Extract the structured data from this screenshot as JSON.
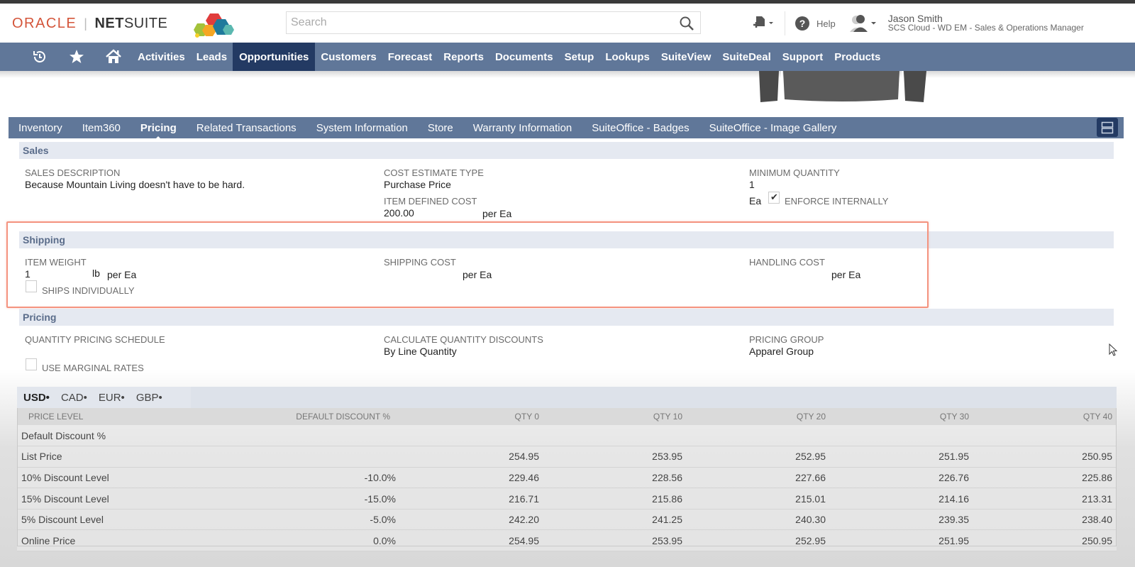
{
  "header": {
    "logo_oracle": "ORACLE",
    "logo_net": "NET",
    "logo_suite": "SUITE",
    "search_placeholder": "Search",
    "help_label": "Help",
    "user_name": "Jason Smith",
    "user_role": "SCS Cloud - WD EM - Sales & Operations Manager"
  },
  "nav": {
    "icons": [
      "recent-history-icon",
      "star-icon",
      "home-icon"
    ],
    "items": [
      {
        "label": "Activities",
        "active": false
      },
      {
        "label": "Leads",
        "active": false
      },
      {
        "label": "Opportunities",
        "active": true
      },
      {
        "label": "Customers",
        "active": false
      },
      {
        "label": "Forecast",
        "active": false
      },
      {
        "label": "Reports",
        "active": false
      },
      {
        "label": "Documents",
        "active": false
      },
      {
        "label": "Setup",
        "active": false
      },
      {
        "label": "Lookups",
        "active": false
      },
      {
        "label": "SuiteView",
        "active": false
      },
      {
        "label": "SuiteDeal",
        "active": false
      },
      {
        "label": "Support",
        "active": false
      },
      {
        "label": "Products",
        "active": false
      }
    ]
  },
  "subtabs": [
    {
      "label": "Inventory",
      "active": false
    },
    {
      "label": "Item360",
      "active": false
    },
    {
      "label": "Pricing",
      "active": true
    },
    {
      "label": "Related Transactions",
      "active": false
    },
    {
      "label": "System Information",
      "active": false
    },
    {
      "label": "Store",
      "active": false
    },
    {
      "label": "Warranty Information",
      "active": false
    },
    {
      "label": "SuiteOffice - Badges",
      "active": false
    },
    {
      "label": "SuiteOffice - Image Gallery",
      "active": false
    }
  ],
  "sales": {
    "title": "Sales",
    "sales_description_label": "Sales Description",
    "sales_description": "Because Mountain Living doesn't have to be hard.",
    "cost_estimate_type_label": "Cost Estimate Type",
    "cost_estimate_type": "Purchase Price",
    "item_defined_cost_label": "Item Defined Cost",
    "item_defined_cost": "200.00",
    "item_defined_cost_unit": "per Ea",
    "minimum_quantity_label": "Minimum Quantity",
    "minimum_quantity": "1",
    "minimum_quantity_unit": "Ea",
    "enforce_internally_label": "Enforce Internally",
    "enforce_internally": true
  },
  "shipping": {
    "title": "Shipping",
    "item_weight_label": "Item Weight",
    "item_weight": "1",
    "item_weight_unit": "lb",
    "item_weight_per": "per Ea",
    "ships_individually_label": "Ships Individually",
    "ships_individually": false,
    "shipping_cost_label": "Shipping Cost",
    "shipping_cost": "",
    "shipping_cost_unit": "per Ea",
    "handling_cost_label": "Handling Cost",
    "handling_cost": "",
    "handling_cost_unit": "per Ea"
  },
  "pricing": {
    "title": "Pricing",
    "quantity_pricing_schedule_label": "Quantity Pricing Schedule",
    "quantity_pricing_schedule": "",
    "use_marginal_rates_label": "Use Marginal Rates",
    "use_marginal_rates": false,
    "calculate_quantity_discounts_label": "Calculate Quantity Discounts",
    "calculate_quantity_discounts": "By Line Quantity",
    "pricing_group_label": "Pricing Group",
    "pricing_group": "Apparel Group"
  },
  "currency_tabs": [
    {
      "label": "USD",
      "active": true
    },
    {
      "label": "CAD",
      "active": false
    },
    {
      "label": "EUR",
      "active": false
    },
    {
      "label": "GBP",
      "active": false
    }
  ],
  "price_table": {
    "columns": [
      "Price Level",
      "Default Discount %",
      "QTY 0",
      "QTY 10",
      "QTY 20",
      "QTY 30",
      "QTY 40"
    ],
    "rows": [
      [
        "Default Discount %",
        "",
        "",
        "",
        "",
        "",
        ""
      ],
      [
        "List Price",
        "",
        "254.95",
        "253.95",
        "252.95",
        "251.95",
        "250.95"
      ],
      [
        "10% Discount Level",
        "-10.0%",
        "229.46",
        "228.56",
        "227.66",
        "226.76",
        "225.86"
      ],
      [
        "15% Discount Level",
        "-15.0%",
        "216.71",
        "215.86",
        "215.01",
        "214.16",
        "213.31"
      ],
      [
        "5% Discount Level",
        "-5.0%",
        "242.20",
        "241.25",
        "240.30",
        "239.35",
        "238.40"
      ],
      [
        "Online Price",
        "0.0%",
        "254.95",
        "253.95",
        "252.95",
        "251.95",
        "250.95"
      ]
    ]
  },
  "colors": {
    "nav_bg": "#607799",
    "nav_active": "#233a63",
    "section_header_bg": "#e5e9f1",
    "highlight_border": "#f4937f",
    "oracle_red": "#d4553a"
  }
}
